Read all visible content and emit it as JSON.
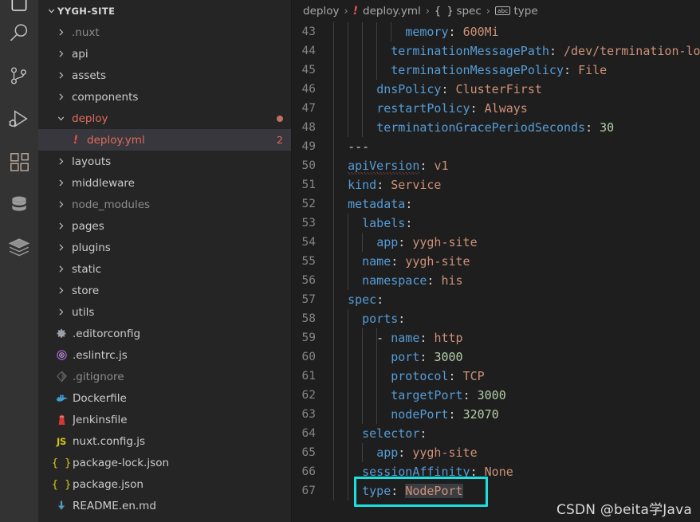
{
  "activity_bar": {
    "items": [
      {
        "name": "explorer-icon",
        "label": "Explorer"
      },
      {
        "name": "search-icon",
        "label": "Search"
      },
      {
        "name": "source-control-icon",
        "label": "Source Control"
      },
      {
        "name": "run-and-debug-icon",
        "label": "Run and Debug"
      },
      {
        "name": "extensions-icon",
        "label": "Extensions"
      },
      {
        "name": "database-icon",
        "label": "Database"
      },
      {
        "name": "docker-icon",
        "label": "Docker"
      }
    ]
  },
  "sidebar": {
    "title": "YYGH-SITE",
    "tree": [
      {
        "label": ".nuxt",
        "type": "folder",
        "expanded": false,
        "depth": 1,
        "dim": true
      },
      {
        "label": "api",
        "type": "folder",
        "expanded": false,
        "depth": 1
      },
      {
        "label": "assets",
        "type": "folder",
        "expanded": false,
        "depth": 1
      },
      {
        "label": "components",
        "type": "folder",
        "expanded": false,
        "depth": 1
      },
      {
        "label": "deploy",
        "type": "folder",
        "expanded": true,
        "depth": 1,
        "error": true,
        "dot": true
      },
      {
        "label": "deploy.yml",
        "type": "yaml",
        "depth": 2,
        "selected": true,
        "error": true,
        "badge": "2"
      },
      {
        "label": "layouts",
        "type": "folder",
        "expanded": false,
        "depth": 1
      },
      {
        "label": "middleware",
        "type": "folder",
        "expanded": false,
        "depth": 1
      },
      {
        "label": "node_modules",
        "type": "folder",
        "expanded": false,
        "depth": 1,
        "dim": true
      },
      {
        "label": "pages",
        "type": "folder",
        "expanded": false,
        "depth": 1
      },
      {
        "label": "plugins",
        "type": "folder",
        "expanded": false,
        "depth": 1
      },
      {
        "label": "static",
        "type": "folder",
        "expanded": false,
        "depth": 1
      },
      {
        "label": "store",
        "type": "folder",
        "expanded": false,
        "depth": 1
      },
      {
        "label": "utils",
        "type": "folder",
        "expanded": false,
        "depth": 1
      },
      {
        "label": ".editorconfig",
        "type": "gear",
        "depth": 1
      },
      {
        "label": ".eslintrc.js",
        "type": "eslint",
        "depth": 1
      },
      {
        "label": ".gitignore",
        "type": "git",
        "depth": 1,
        "dim": true
      },
      {
        "label": "Dockerfile",
        "type": "docker",
        "depth": 1
      },
      {
        "label": "Jenkinsfile",
        "type": "jenkins",
        "depth": 1
      },
      {
        "label": "nuxt.config.js",
        "type": "js",
        "depth": 1
      },
      {
        "label": "package-lock.json",
        "type": "json",
        "depth": 1
      },
      {
        "label": "package.json",
        "type": "json",
        "depth": 1
      },
      {
        "label": "README.en.md",
        "type": "md",
        "depth": 1
      }
    ]
  },
  "breadcrumb": {
    "segments": [
      {
        "label": "deploy",
        "icon": "none"
      },
      {
        "label": "deploy.yml",
        "icon": "yaml-error-icon"
      },
      {
        "label": "spec",
        "icon": "json-braces-icon"
      },
      {
        "label": "type",
        "icon": "abc-string-icon"
      }
    ],
    "separator": "›"
  },
  "editor": {
    "first_line_number": 43,
    "lines": [
      {
        "n": 43,
        "tokens": [
          {
            "t": "          ",
            "c": "p"
          },
          {
            "t": "memory",
            "c": "k"
          },
          {
            "t": ": ",
            "c": "p"
          },
          {
            "t": "600Mi",
            "c": "s"
          }
        ]
      },
      {
        "n": 44,
        "tokens": [
          {
            "t": "        ",
            "c": "p"
          },
          {
            "t": "terminationMessagePath",
            "c": "k"
          },
          {
            "t": ": ",
            "c": "p"
          },
          {
            "t": "/dev/termination-log",
            "c": "s"
          }
        ]
      },
      {
        "n": 45,
        "tokens": [
          {
            "t": "        ",
            "c": "p"
          },
          {
            "t": "terminationMessagePolicy",
            "c": "k"
          },
          {
            "t": ": ",
            "c": "p"
          },
          {
            "t": "File",
            "c": "s"
          }
        ]
      },
      {
        "n": 46,
        "tokens": [
          {
            "t": "      ",
            "c": "p"
          },
          {
            "t": "dnsPolicy",
            "c": "k"
          },
          {
            "t": ": ",
            "c": "p"
          },
          {
            "t": "ClusterFirst",
            "c": "s"
          }
        ]
      },
      {
        "n": 47,
        "tokens": [
          {
            "t": "      ",
            "c": "p"
          },
          {
            "t": "restartPolicy",
            "c": "k"
          },
          {
            "t": ": ",
            "c": "p"
          },
          {
            "t": "Always",
            "c": "s"
          }
        ]
      },
      {
        "n": 48,
        "tokens": [
          {
            "t": "      ",
            "c": "p"
          },
          {
            "t": "terminationGracePeriodSeconds",
            "c": "k"
          },
          {
            "t": ": ",
            "c": "p"
          },
          {
            "t": "30",
            "c": "n"
          }
        ]
      },
      {
        "n": 49,
        "tokens": [
          {
            "t": "  ",
            "c": "p"
          },
          {
            "t": "---",
            "c": "p"
          }
        ]
      },
      {
        "n": 50,
        "tokens": [
          {
            "t": "  ",
            "c": "p"
          },
          {
            "t": "apiVersion",
            "c": "k sq"
          },
          {
            "t": ": ",
            "c": "p"
          },
          {
            "t": "v1",
            "c": "s"
          }
        ]
      },
      {
        "n": 51,
        "tokens": [
          {
            "t": "  ",
            "c": "p"
          },
          {
            "t": "kind",
            "c": "k"
          },
          {
            "t": ": ",
            "c": "p"
          },
          {
            "t": "Service",
            "c": "s"
          }
        ]
      },
      {
        "n": 52,
        "tokens": [
          {
            "t": "  ",
            "c": "p"
          },
          {
            "t": "metadata",
            "c": "k"
          },
          {
            "t": ":",
            "c": "p"
          }
        ]
      },
      {
        "n": 53,
        "tokens": [
          {
            "t": "    ",
            "c": "p"
          },
          {
            "t": "labels",
            "c": "k"
          },
          {
            "t": ":",
            "c": "p"
          }
        ]
      },
      {
        "n": 54,
        "tokens": [
          {
            "t": "      ",
            "c": "p"
          },
          {
            "t": "app",
            "c": "k"
          },
          {
            "t": ": ",
            "c": "p"
          },
          {
            "t": "yygh-site",
            "c": "s"
          }
        ]
      },
      {
        "n": 55,
        "tokens": [
          {
            "t": "    ",
            "c": "p"
          },
          {
            "t": "name",
            "c": "k"
          },
          {
            "t": ": ",
            "c": "p"
          },
          {
            "t": "yygh-site",
            "c": "s"
          }
        ]
      },
      {
        "n": 56,
        "tokens": [
          {
            "t": "    ",
            "c": "p"
          },
          {
            "t": "namespace",
            "c": "k"
          },
          {
            "t": ": ",
            "c": "p"
          },
          {
            "t": "his",
            "c": "s"
          }
        ]
      },
      {
        "n": 57,
        "tokens": [
          {
            "t": "  ",
            "c": "p"
          },
          {
            "t": "spec",
            "c": "k"
          },
          {
            "t": ":",
            "c": "p"
          }
        ]
      },
      {
        "n": 58,
        "tokens": [
          {
            "t": "    ",
            "c": "p"
          },
          {
            "t": "ports",
            "c": "k"
          },
          {
            "t": ":",
            "c": "p"
          }
        ]
      },
      {
        "n": 59,
        "tokens": [
          {
            "t": "      - ",
            "c": "p"
          },
          {
            "t": "name",
            "c": "k"
          },
          {
            "t": ": ",
            "c": "p"
          },
          {
            "t": "http",
            "c": "s"
          }
        ]
      },
      {
        "n": 60,
        "tokens": [
          {
            "t": "        ",
            "c": "p"
          },
          {
            "t": "port",
            "c": "k"
          },
          {
            "t": ": ",
            "c": "p"
          },
          {
            "t": "3000",
            "c": "n"
          }
        ]
      },
      {
        "n": 61,
        "tokens": [
          {
            "t": "        ",
            "c": "p"
          },
          {
            "t": "protocol",
            "c": "k"
          },
          {
            "t": ": ",
            "c": "p"
          },
          {
            "t": "TCP",
            "c": "s"
          }
        ]
      },
      {
        "n": 62,
        "tokens": [
          {
            "t": "        ",
            "c": "p"
          },
          {
            "t": "targetPort",
            "c": "k"
          },
          {
            "t": ": ",
            "c": "p"
          },
          {
            "t": "3000",
            "c": "n"
          }
        ]
      },
      {
        "n": 63,
        "tokens": [
          {
            "t": "        ",
            "c": "p"
          },
          {
            "t": "nodePort",
            "c": "k"
          },
          {
            "t": ": ",
            "c": "p"
          },
          {
            "t": "32070",
            "c": "n"
          }
        ]
      },
      {
        "n": 64,
        "tokens": [
          {
            "t": "    ",
            "c": "p"
          },
          {
            "t": "selector",
            "c": "k"
          },
          {
            "t": ":",
            "c": "p"
          }
        ]
      },
      {
        "n": 65,
        "tokens": [
          {
            "t": "      ",
            "c": "p"
          },
          {
            "t": "app",
            "c": "k"
          },
          {
            "t": ": ",
            "c": "p"
          },
          {
            "t": "yygh-site",
            "c": "s"
          }
        ]
      },
      {
        "n": 66,
        "tokens": [
          {
            "t": "    ",
            "c": "p"
          },
          {
            "t": "sessionAffinity",
            "c": "k"
          },
          {
            "t": ": ",
            "c": "p"
          },
          {
            "t": "None",
            "c": "s"
          }
        ]
      },
      {
        "n": 67,
        "tokens": [
          {
            "t": "    ",
            "c": "p"
          },
          {
            "t": "type",
            "c": "k"
          },
          {
            "t": ": ",
            "c": "p"
          },
          {
            "t": "NodePort",
            "c": "s sel-tok"
          }
        ]
      }
    ],
    "highlight": {
      "line": 67,
      "color": "#1ce0e0"
    }
  },
  "watermark": {
    "text": "CSDN @beita学Java"
  },
  "colors": {
    "activity_bar_bg": "#333333",
    "sidebar_bg": "#252526",
    "editor_bg": "#1e1e1e",
    "selected_row_bg": "#37373d",
    "key": "#569cd6",
    "string": "#ce9178",
    "number": "#b5cea8",
    "error": "#e0534a",
    "accent_highlight": "#1ce0e0"
  }
}
